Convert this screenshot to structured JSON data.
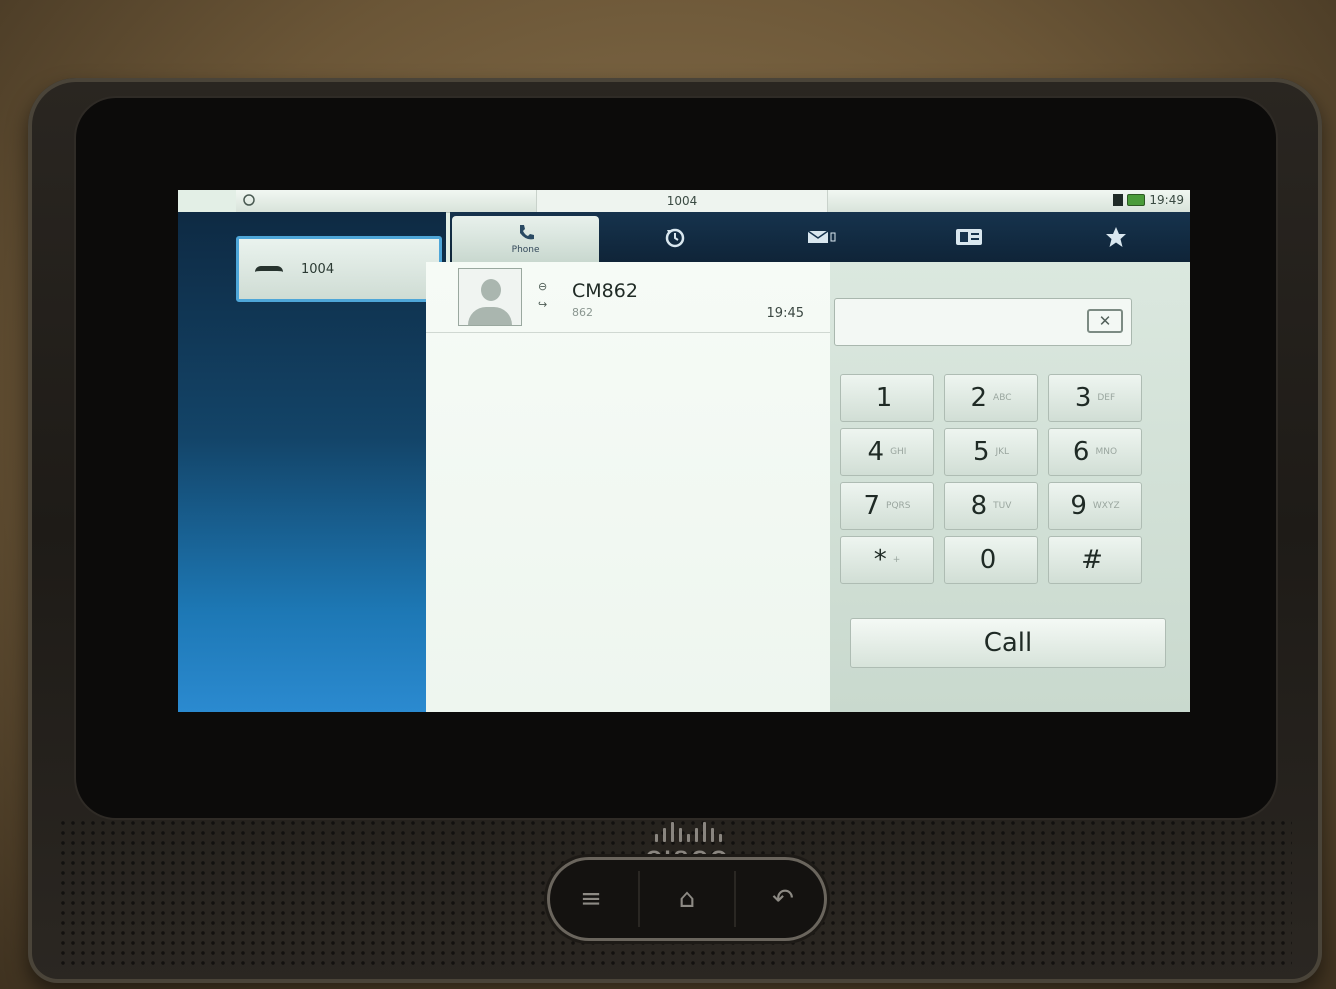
{
  "status_bar": {
    "title": "1004",
    "clock": "19:49"
  },
  "line": {
    "label": "1004"
  },
  "tabs": [
    {
      "icon": "phone-icon",
      "label": "Phone",
      "active": true
    },
    {
      "icon": "history-icon",
      "label": "",
      "active": false
    },
    {
      "icon": "voicemail-icon",
      "label": "",
      "active": false
    },
    {
      "icon": "contacts-icon",
      "label": "",
      "active": false
    },
    {
      "icon": "star-icon",
      "label": "",
      "active": false
    }
  ],
  "recents": [
    {
      "name": "CM862",
      "number": "862",
      "time": "19:45"
    }
  ],
  "dialer": {
    "input_value": "",
    "keys": [
      {
        "digit": "1",
        "letters": ""
      },
      {
        "digit": "2",
        "letters": "ABC"
      },
      {
        "digit": "3",
        "letters": "DEF"
      },
      {
        "digit": "4",
        "letters": "GHI"
      },
      {
        "digit": "5",
        "letters": "JKL"
      },
      {
        "digit": "6",
        "letters": "MNO"
      },
      {
        "digit": "7",
        "letters": "PQRS"
      },
      {
        "digit": "8",
        "letters": "TUV"
      },
      {
        "digit": "9",
        "letters": "WXYZ"
      },
      {
        "digit": "*",
        "letters": "+"
      },
      {
        "digit": "0",
        "letters": ""
      },
      {
        "digit": "#",
        "letters": ""
      }
    ],
    "call_label": "Call"
  },
  "device": {
    "brand": "CISCO"
  }
}
